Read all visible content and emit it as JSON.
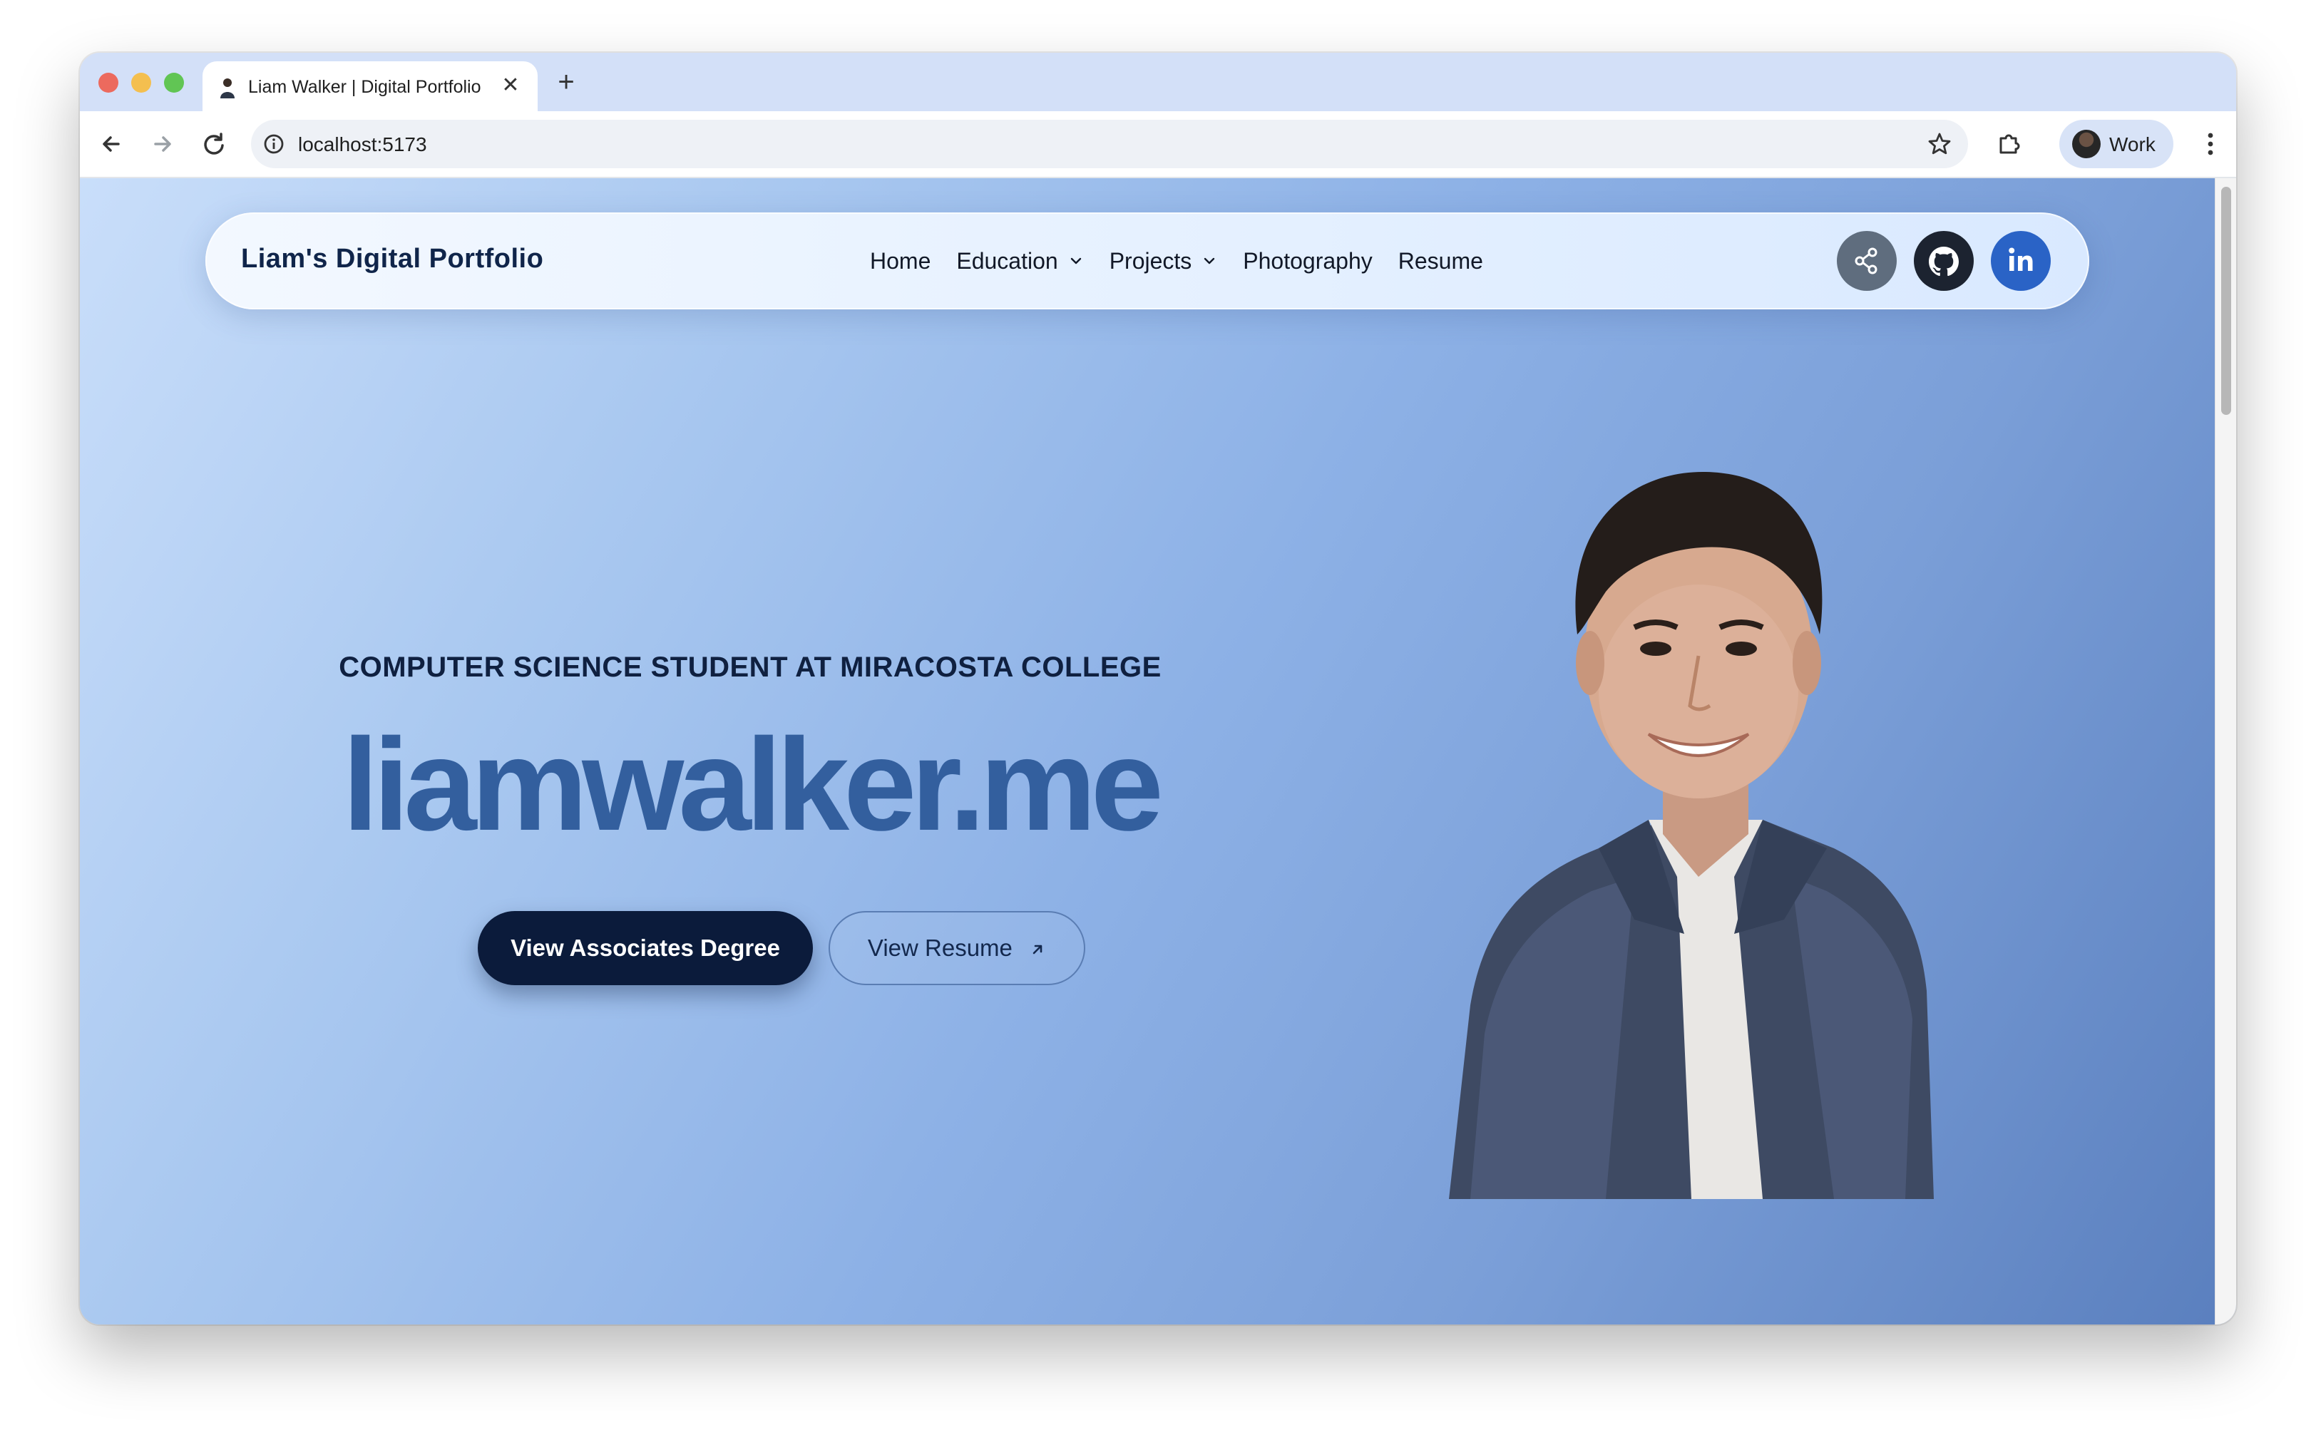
{
  "browser": {
    "tab_title": "Liam Walker | Digital Portfolio",
    "tab_close": "✕",
    "new_tab": "+",
    "url": "localhost:5173",
    "profile_label": "Work"
  },
  "navbar": {
    "brand": "Liam's Digital Portfolio",
    "links": [
      {
        "label": "Home"
      },
      {
        "label": "Education",
        "dropdown": true
      },
      {
        "label": "Projects",
        "dropdown": true
      },
      {
        "label": "Photography"
      },
      {
        "label": "Resume"
      }
    ],
    "socials": [
      "share-icon",
      "github-icon",
      "linkedin-icon"
    ]
  },
  "hero": {
    "subtitle": "COMPUTER SCIENCE STUDENT AT MIRACOSTA COLLEGE",
    "title": "liamwalker.me",
    "primary_button": "View Associates Degree",
    "secondary_button": "View Resume"
  },
  "colors": {
    "brand_dark": "#0b1b3b",
    "title_blue": "#335f9e",
    "linkedin_blue": "#2a63c6"
  }
}
